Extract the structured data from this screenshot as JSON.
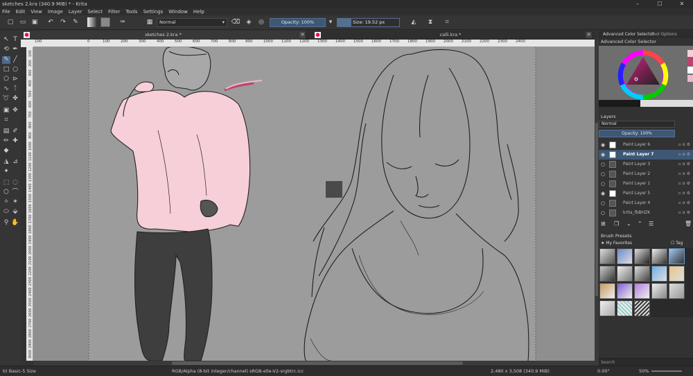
{
  "window": {
    "title": "sketches 2.kra (340.9 MiB) * - Krita",
    "min": "–",
    "max": "☐",
    "close": "✕"
  },
  "menu": [
    "File",
    "Edit",
    "View",
    "Image",
    "Layer",
    "Select",
    "Filter",
    "Tools",
    "Settings",
    "Window",
    "Help"
  ],
  "toolbar": {
    "blend_mode": "Normal",
    "opacity_label": "Opacity: 100%",
    "size_label": "Size: 19.52 px"
  },
  "tabs": [
    {
      "label": "sketches 2.kra *",
      "close": "✕"
    },
    {
      "label": "calli.kra *",
      "close": "✕"
    }
  ],
  "ruler_h": [
    "100",
    "0",
    "100",
    "200",
    "300",
    "400",
    "500",
    "600",
    "700",
    "800",
    "900",
    "1000",
    "1100",
    "1200",
    "1300",
    "1400",
    "1500",
    "1600",
    "1700",
    "1800",
    "1900",
    "2000",
    "2100",
    "2200",
    "2300",
    "2400"
  ],
  "ruler_v": [
    "100",
    "200",
    "300",
    "400",
    "500",
    "600",
    "700",
    "800",
    "900",
    "1000",
    "1100",
    "1200",
    "1300",
    "1400",
    "1500",
    "1600",
    "1700",
    "1800",
    "1900",
    "2000",
    "2100",
    "2200",
    "2300",
    "2400",
    "2500",
    "2600",
    "2700",
    "2800",
    "2900",
    "3000"
  ],
  "dock": {
    "tabs": [
      "Advanced Color Selector",
      "Tool Options"
    ],
    "color_header": "Advanced Color Selector",
    "layers_header": "Layers",
    "layer_blend": "Normal",
    "layer_opacity": "Opacity:  100%",
    "layers": [
      {
        "name": "Paint Layer 6",
        "visible": true,
        "selected": false,
        "thumb": "#ffffff"
      },
      {
        "name": "Paint Layer 7",
        "visible": true,
        "selected": true,
        "thumb": "#ffffff"
      },
      {
        "name": "Paint Layer 3",
        "visible": false,
        "selected": false,
        "thumb": "#555555"
      },
      {
        "name": "Paint Layer 2",
        "visible": false,
        "selected": false,
        "thumb": "#555555"
      },
      {
        "name": "Paint Layer 1",
        "visible": false,
        "selected": false,
        "thumb": "#555555"
      },
      {
        "name": "Paint Layer 5",
        "visible": true,
        "selected": false,
        "thumb": "#ffffff"
      },
      {
        "name": "Paint Layer 4",
        "visible": false,
        "selected": false,
        "thumb": "#555555"
      },
      {
        "name": "krita_fbBHZK",
        "visible": false,
        "selected": false,
        "thumb": "#555555"
      }
    ],
    "presets_header": "Brush Presets",
    "presets_tag": "My Favorites",
    "presets_tag_btn": "Tag",
    "search_placeholder": "Search"
  },
  "status": {
    "brush": "b) Basic-5 Size",
    "color_profile": "RGB/Alpha (8-bit integer/channel)  sRGB-elle-V2-srgbtrc.icc",
    "dimensions": "2,480 x 3,508 (340.9 MiB)",
    "rotation": "0.00°",
    "zoom": "50%"
  },
  "colors": {
    "accent": "#3d5775",
    "canvas": "#8f8f8f",
    "shirt": "#f7cfd8"
  }
}
